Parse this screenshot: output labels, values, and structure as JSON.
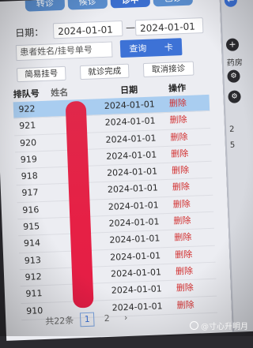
{
  "tabs": [
    {
      "label": "转诊"
    },
    {
      "label": "候诊"
    },
    {
      "label": "诊中"
    },
    {
      "label": "已诊"
    }
  ],
  "filter": {
    "date_label": "日期：",
    "date_from": "2024-01-01",
    "date_sep": "—",
    "date_to": "2024-01-01",
    "search_placeholder": "患者姓名/挂号单号",
    "query_label": "查询",
    "card_label": "卡"
  },
  "actions": {
    "simple_register": "简易挂号",
    "finish_visit": "就诊完成",
    "cancel_receive": "取消接诊"
  },
  "table": {
    "headers": {
      "queue_no": "排队号",
      "name": "姓名",
      "date": "日期",
      "action": "操作"
    },
    "rows": [
      {
        "queue_no": "922",
        "name": "",
        "date": "2024-01-01",
        "action": "删除"
      },
      {
        "queue_no": "921",
        "name": "",
        "date": "2024-01-01",
        "action": "删除"
      },
      {
        "queue_no": "920",
        "name": "",
        "date": "2024-01-01",
        "action": "删除"
      },
      {
        "queue_no": "919",
        "name": "",
        "date": "2024-01-01",
        "action": "删除"
      },
      {
        "queue_no": "918",
        "name": "",
        "date": "2024-01-01",
        "action": "删除"
      },
      {
        "queue_no": "917",
        "name": "",
        "date": "2024-01-01",
        "action": "删除"
      },
      {
        "queue_no": "916",
        "name": "",
        "date": "2024-01-01",
        "action": "删除"
      },
      {
        "queue_no": "915",
        "name": "",
        "date": "2024-01-01",
        "action": "删除"
      },
      {
        "queue_no": "914",
        "name": "",
        "date": "2024-01-01",
        "action": "删除"
      },
      {
        "queue_no": "913",
        "name": "",
        "date": "2024-01-01",
        "action": "删除"
      },
      {
        "queue_no": "912",
        "name": "",
        "date": "2024-01-01",
        "action": "删除"
      },
      {
        "queue_no": "911",
        "name": "",
        "date": "2024-01-01",
        "action": "删除"
      },
      {
        "queue_no": "910",
        "name": "",
        "date": "2024-01-01",
        "action": "删除"
      }
    ]
  },
  "pagination": {
    "total": "共22条",
    "page1": "1",
    "page2": "2",
    "next": "›"
  },
  "side_panel": {
    "plus": "+",
    "pharmacy": "药房",
    "count_1": "2",
    "count_2": "5",
    "back": "←"
  },
  "watermark": "@寸心升明月",
  "colors": {
    "primary": "#3d72d6",
    "tab": "#5b8fd0",
    "selected_row": "#a9cdf0",
    "delete": "#d23030",
    "redaction": "#e41d45"
  }
}
